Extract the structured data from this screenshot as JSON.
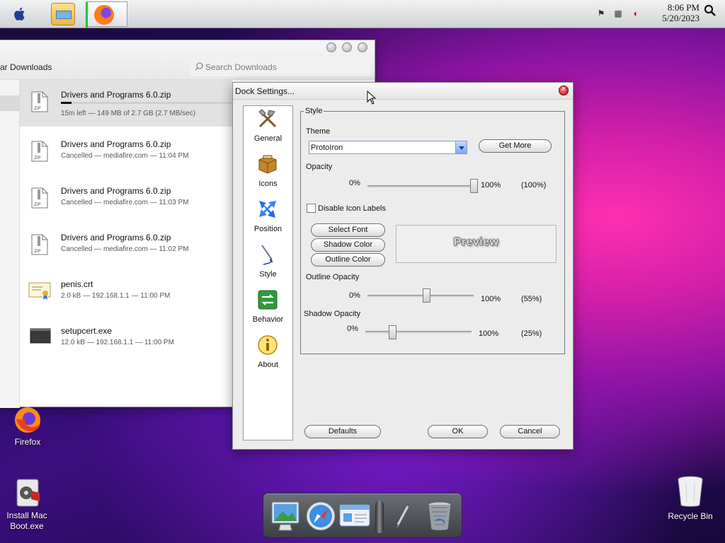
{
  "menubar": {
    "clock_time": "8:06 PM",
    "clock_date": "5/20/2023",
    "icons": [
      "apple-icon",
      "file-explorer-icon",
      "firefox-icon",
      "flag-icon",
      "network-icon",
      "volume-muted-icon",
      "search-icon"
    ]
  },
  "downloads": {
    "title": "ar Downloads",
    "search_placeholder": "Search Downloads",
    "items": [
      {
        "name": "Drivers and Programs 6.0.zip",
        "status": "15m left — 149 MB of 2.7 GB (2.7 MB/sec)",
        "progress": 0.06,
        "icon": "zip-file-icon"
      },
      {
        "name": "Drivers and Programs 6.0.zip",
        "status": "Cancelled — mediafire.com — 11:04 PM",
        "icon": "zip-file-icon"
      },
      {
        "name": "Drivers and Programs 6.0.zip",
        "status": "Cancelled — mediafire.com — 11:03 PM",
        "icon": "zip-file-icon"
      },
      {
        "name": "Drivers and Programs 6.0.zip",
        "status": "Cancelled — mediafire.com — 11:02 PM",
        "icon": "zip-file-icon"
      },
      {
        "name": "penis.crt",
        "status": "2.0 kB — 192.168.1.1 — 11:00 PM",
        "icon": "certificate-icon"
      },
      {
        "name": "setupcert.exe",
        "status": "12.0 kB — 192.168.1.1 — 11:00 PM",
        "icon": "executable-icon"
      }
    ]
  },
  "dock_settings": {
    "title": "Dock Settings...",
    "nav": [
      {
        "label": "General",
        "icon": "tools-icon"
      },
      {
        "label": "Icons",
        "icon": "box-icon"
      },
      {
        "label": "Position",
        "icon": "move-arrows-icon"
      },
      {
        "label": "Style",
        "icon": "brush-icon"
      },
      {
        "label": "Behavior",
        "icon": "exchange-arrows-icon"
      },
      {
        "label": "About",
        "icon": "info-icon"
      }
    ],
    "style_group_label": "Style",
    "theme_label": "Theme",
    "theme_value": "ProtoIron",
    "get_more_label": "Get More",
    "opacity_label": "Opacity",
    "opacity_min": "0%",
    "opacity_max": "100%",
    "opacity_value": "(100%)",
    "opacity_fraction": 1.0,
    "disable_labels_label": "Disable Icon Labels",
    "disable_labels_checked": false,
    "select_font_label": "Select Font",
    "shadow_color_label": "Shadow Color",
    "outline_color_label": "Outline Color",
    "preview_text": "Preview",
    "outline_opacity_label": "Outline Opacity",
    "outline_min": "0%",
    "outline_max": "100%",
    "outline_value": "(55%)",
    "outline_fraction": 0.55,
    "shadow_opacity_label": "Shadow Opacity",
    "shadow_min": "0%",
    "shadow_max": "100%",
    "shadow_value": "(25%)",
    "shadow_fraction": 0.25,
    "defaults_label": "Defaults",
    "ok_label": "OK",
    "cancel_label": "Cancel"
  },
  "desktop": {
    "firefox_label": "Firefox",
    "install_label_line1": "Install Mac",
    "install_label_line2": "Boot.exe",
    "recycle_label": "Recycle Bin"
  },
  "dock": {
    "items": [
      "finder-display-icon",
      "safari-compass-icon",
      "system-preferences-icon",
      "dock-separator",
      "pen-icon",
      "trash-icon"
    ]
  }
}
